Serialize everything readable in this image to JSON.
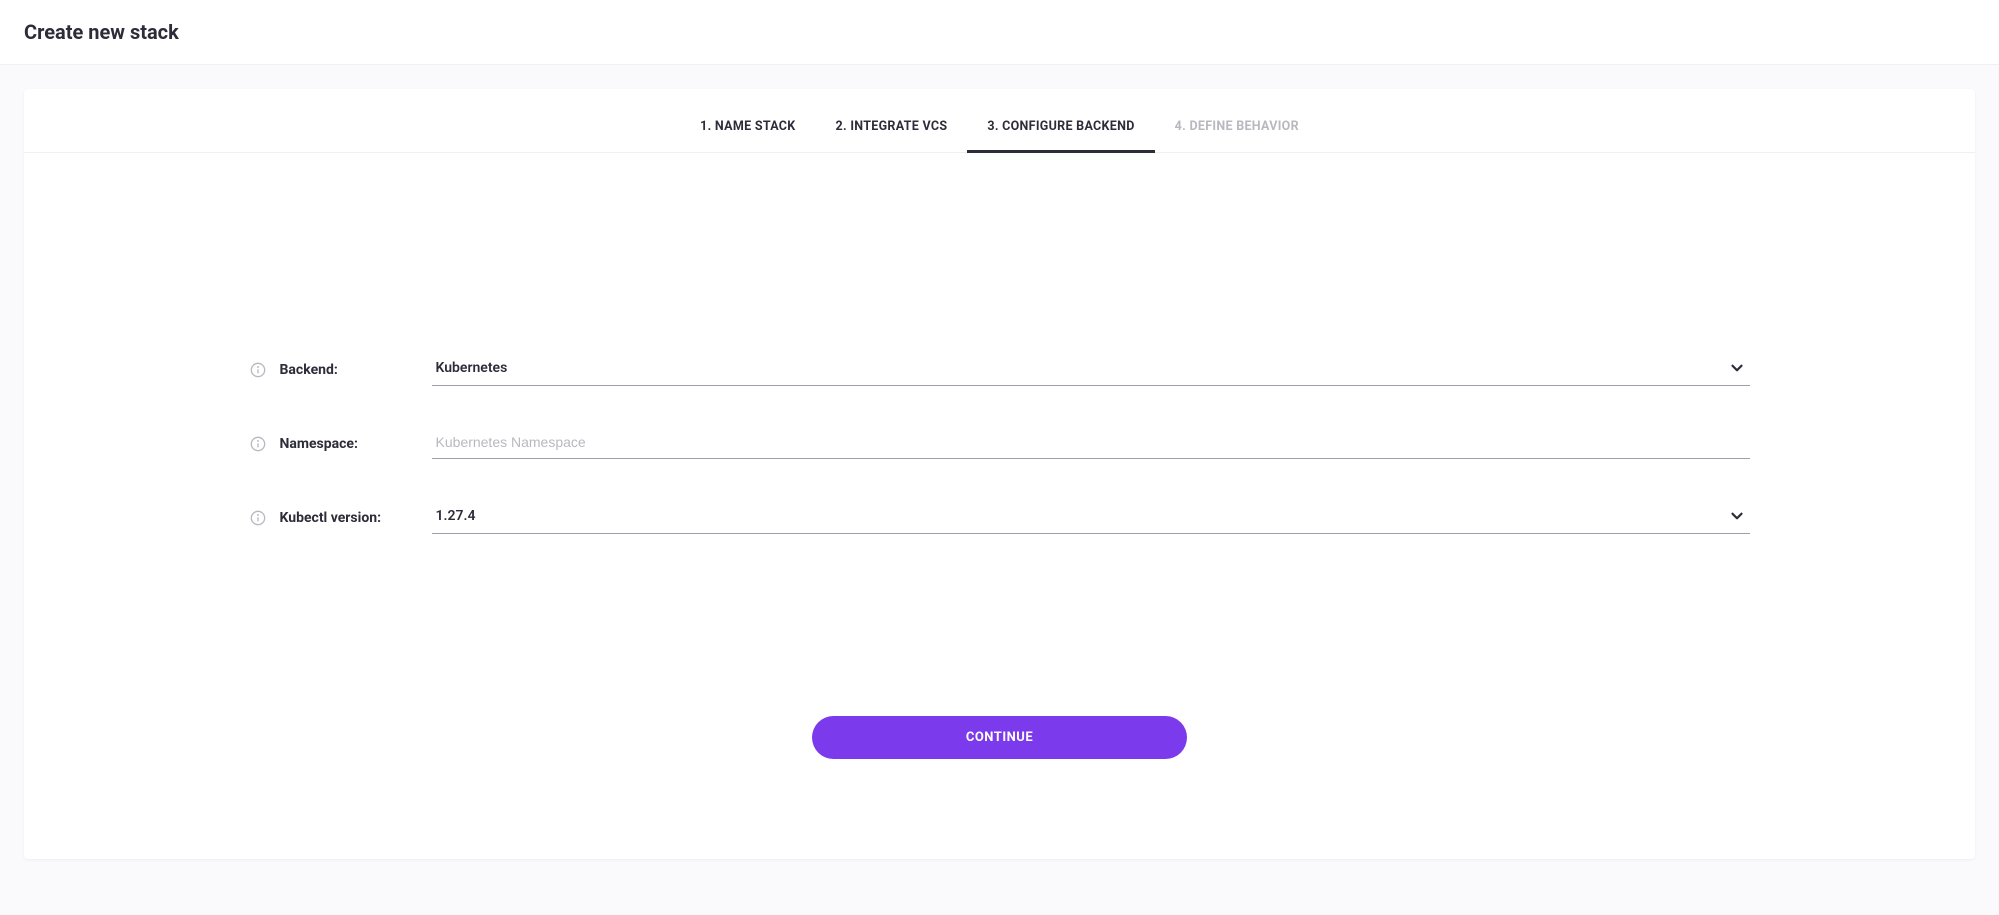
{
  "header": {
    "title": "Create new stack"
  },
  "tabs": [
    {
      "label": "1. NAME STACK",
      "active": false,
      "disabled": false
    },
    {
      "label": "2. INTEGRATE VCS",
      "active": false,
      "disabled": false
    },
    {
      "label": "3. CONFIGURE BACKEND",
      "active": true,
      "disabled": false
    },
    {
      "label": "4. DEFINE BEHAVIOR",
      "active": false,
      "disabled": true
    }
  ],
  "form": {
    "backend": {
      "label": "Backend:",
      "value": "Kubernetes"
    },
    "namespace": {
      "label": "Namespace:",
      "placeholder": "Kubernetes Namespace",
      "value": ""
    },
    "kubectl_version": {
      "label": "Kubectl version:",
      "value": "1.27.4"
    }
  },
  "actions": {
    "continue": "CONTINUE"
  },
  "colors": {
    "primary": "#7c3aed",
    "text": "#2d2d3a",
    "muted": "#b8b8c0"
  }
}
